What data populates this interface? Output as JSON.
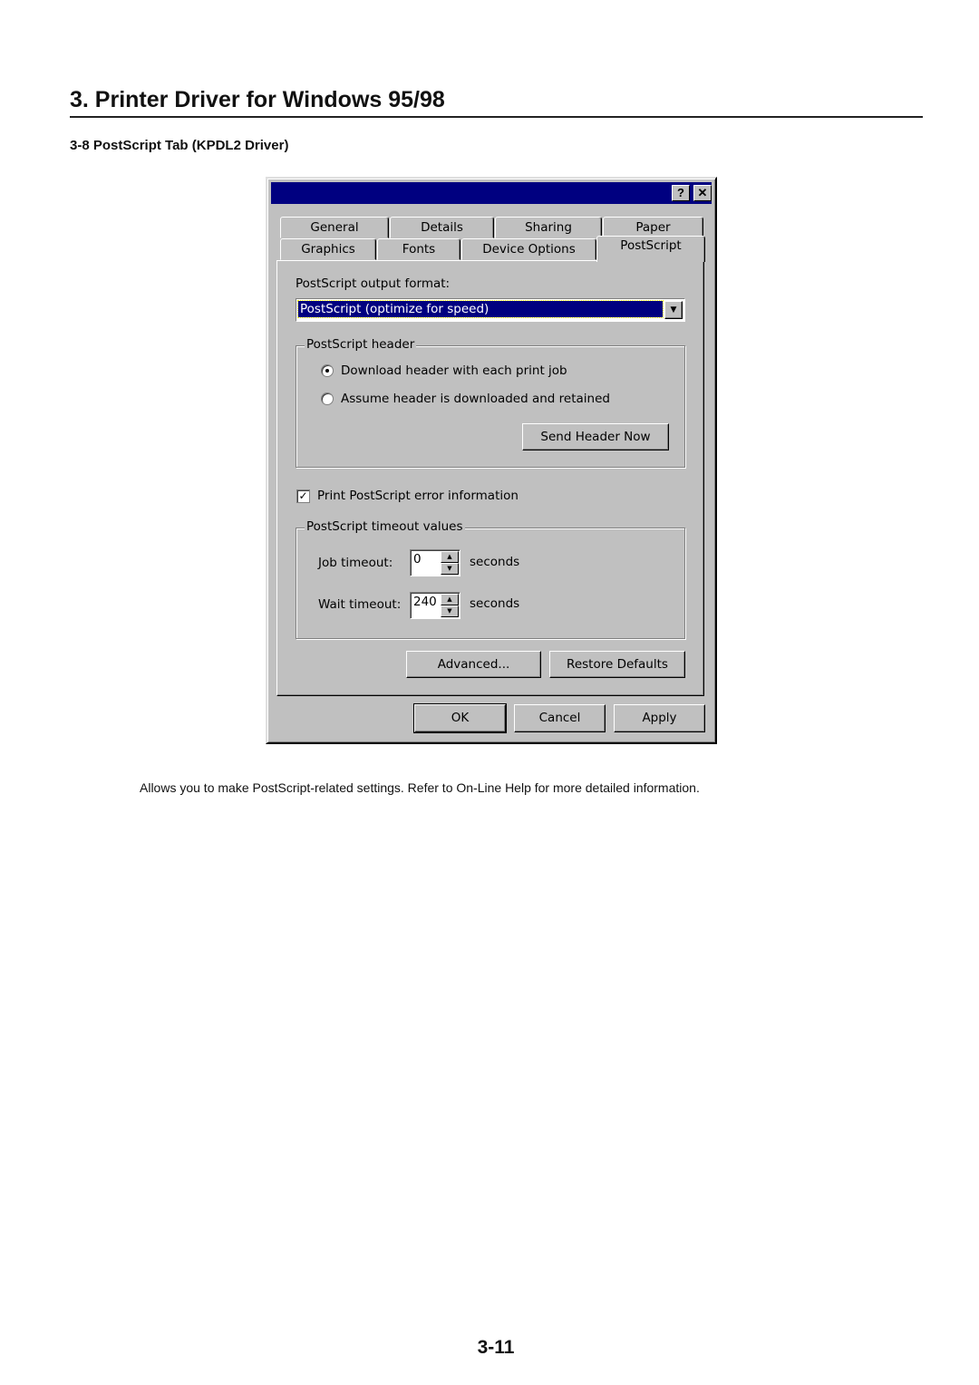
{
  "page": {
    "heading": "3. Printer Driver for Windows 95/98",
    "subheading": "3-8 PostScript Tab (KPDL2 Driver)",
    "caption": "Allows you to make PostScript-related settings. Refer to On-Line Help for more detailed information.",
    "page_number": "3-11"
  },
  "dialog": {
    "title_buttons": {
      "help": "?",
      "close": "✕"
    },
    "tabs_row1": [
      "General",
      "Details",
      "Sharing",
      "Paper"
    ],
    "tabs_row2": [
      "Graphics",
      "Fonts",
      "Device Options",
      "PostScript"
    ],
    "active_tab": "PostScript",
    "output_format_label": "PostScript output format:",
    "output_format_value": "PostScript (optimize for speed)",
    "header_group": {
      "label": "PostScript header",
      "radio1": "Download header with each print job",
      "radio2": "Assume header is downloaded and retained",
      "selected": 1,
      "send_button": "Send Header Now"
    },
    "error_checkbox": {
      "label": "Print PostScript error information",
      "checked": true
    },
    "timeout_group": {
      "label": "PostScript timeout values",
      "job_label": "Job timeout:",
      "job_value": "0",
      "wait_label": "Wait timeout:",
      "wait_value": "240",
      "unit": "seconds"
    },
    "advanced_button": "Advanced...",
    "restore_button": "Restore Defaults",
    "ok_button": "OK",
    "cancel_button": "Cancel",
    "apply_button": "Apply"
  },
  "colors": {
    "title_bar": "#000080",
    "face": "#c0c0c0"
  }
}
